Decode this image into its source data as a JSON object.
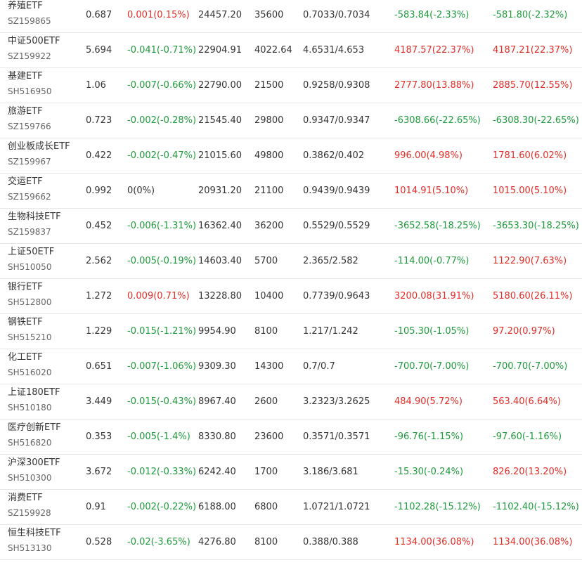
{
  "colors": {
    "up": "#e52d27",
    "down": "#1e9b3c",
    "flat": "#333333",
    "border": "#e8e8e8"
  },
  "rows": [
    {
      "name": "养殖ETF",
      "code": "SZ159865",
      "price": "0.687",
      "change": "0.001(0.15%)",
      "change_dir": "up",
      "amount": "24457.20",
      "shares": "35600",
      "range": "0.7033/0.7034",
      "pl1": "-583.84(-2.33%)",
      "pl1_dir": "down",
      "pl2": "-581.80(-2.32%)",
      "pl2_dir": "down"
    },
    {
      "name": "中证500ETF",
      "code": "SZ159922",
      "price": "5.694",
      "change": "-0.041(-0.71%)",
      "change_dir": "down",
      "amount": "22904.91",
      "shares": "4022.64",
      "range": "4.6531/4.653",
      "pl1": "4187.57(22.37%)",
      "pl1_dir": "up",
      "pl2": "4187.21(22.37%)",
      "pl2_dir": "up"
    },
    {
      "name": "基建ETF",
      "code": "SH516950",
      "price": "1.06",
      "change": "-0.007(-0.66%)",
      "change_dir": "down",
      "amount": "22790.00",
      "shares": "21500",
      "range": "0.9258/0.9308",
      "pl1": "2777.80(13.88%)",
      "pl1_dir": "up",
      "pl2": "2885.70(12.55%)",
      "pl2_dir": "up"
    },
    {
      "name": "旅游ETF",
      "code": "SZ159766",
      "price": "0.723",
      "change": "-0.002(-0.28%)",
      "change_dir": "down",
      "amount": "21545.40",
      "shares": "29800",
      "range": "0.9347/0.9347",
      "pl1": "-6308.66(-22.65%)",
      "pl1_dir": "down",
      "pl2": "-6308.30(-22.65%)",
      "pl2_dir": "down"
    },
    {
      "name": "创业板成长ETF",
      "code": "SZ159967",
      "price": "0.422",
      "change": "-0.002(-0.47%)",
      "change_dir": "down",
      "amount": "21015.60",
      "shares": "49800",
      "range": "0.3862/0.402",
      "pl1": "996.00(4.98%)",
      "pl1_dir": "up",
      "pl2": "1781.60(6.02%)",
      "pl2_dir": "up"
    },
    {
      "name": "交运ETF",
      "code": "SZ159662",
      "price": "0.992",
      "change": "0(0%)",
      "change_dir": "flat",
      "amount": "20931.20",
      "shares": "21100",
      "range": "0.9439/0.9439",
      "pl1": "1014.91(5.10%)",
      "pl1_dir": "up",
      "pl2": "1015.00(5.10%)",
      "pl2_dir": "up"
    },
    {
      "name": "生物科技ETF",
      "code": "SZ159837",
      "price": "0.452",
      "change": "-0.006(-1.31%)",
      "change_dir": "down",
      "amount": "16362.40",
      "shares": "36200",
      "range": "0.5529/0.5529",
      "pl1": "-3652.58(-18.25%)",
      "pl1_dir": "down",
      "pl2": "-3653.30(-18.25%)",
      "pl2_dir": "down"
    },
    {
      "name": "上证50ETF",
      "code": "SH510050",
      "price": "2.562",
      "change": "-0.005(-0.19%)",
      "change_dir": "down",
      "amount": "14603.40",
      "shares": "5700",
      "range": "2.365/2.582",
      "pl1": "-114.00(-0.77%)",
      "pl1_dir": "down",
      "pl2": "1122.90(7.63%)",
      "pl2_dir": "up"
    },
    {
      "name": "银行ETF",
      "code": "SH512800",
      "price": "1.272",
      "change": "0.009(0.71%)",
      "change_dir": "up",
      "amount": "13228.80",
      "shares": "10400",
      "range": "0.7739/0.9643",
      "pl1": "3200.08(31.91%)",
      "pl1_dir": "up",
      "pl2": "5180.60(26.11%)",
      "pl2_dir": "up"
    },
    {
      "name": "钢铁ETF",
      "code": "SH515210",
      "price": "1.229",
      "change": "-0.015(-1.21%)",
      "change_dir": "down",
      "amount": "9954.90",
      "shares": "8100",
      "range": "1.217/1.242",
      "pl1": "-105.30(-1.05%)",
      "pl1_dir": "down",
      "pl2": "97.20(0.97%)",
      "pl2_dir": "up"
    },
    {
      "name": "化工ETF",
      "code": "SH516020",
      "price": "0.651",
      "change": "-0.007(-1.06%)",
      "change_dir": "down",
      "amount": "9309.30",
      "shares": "14300",
      "range": "0.7/0.7",
      "pl1": "-700.70(-7.00%)",
      "pl1_dir": "down",
      "pl2": "-700.70(-7.00%)",
      "pl2_dir": "down"
    },
    {
      "name": "上证180ETF",
      "code": "SH510180",
      "price": "3.449",
      "change": "-0.015(-0.43%)",
      "change_dir": "down",
      "amount": "8967.40",
      "shares": "2600",
      "range": "3.2323/3.2625",
      "pl1": "484.90(5.72%)",
      "pl1_dir": "up",
      "pl2": "563.40(6.64%)",
      "pl2_dir": "up"
    },
    {
      "name": "医疗创新ETF",
      "code": "SH516820",
      "price": "0.353",
      "change": "-0.005(-1.4%)",
      "change_dir": "down",
      "amount": "8330.80",
      "shares": "23600",
      "range": "0.3571/0.3571",
      "pl1": "-96.76(-1.15%)",
      "pl1_dir": "down",
      "pl2": "-97.60(-1.16%)",
      "pl2_dir": "down"
    },
    {
      "name": "沪深300ETF",
      "code": "SH510300",
      "price": "3.672",
      "change": "-0.012(-0.33%)",
      "change_dir": "down",
      "amount": "6242.40",
      "shares": "1700",
      "range": "3.186/3.681",
      "pl1": "-15.30(-0.24%)",
      "pl1_dir": "down",
      "pl2": "826.20(13.20%)",
      "pl2_dir": "up"
    },
    {
      "name": "消费ETF",
      "code": "SZ159928",
      "price": "0.91",
      "change": "-0.002(-0.22%)",
      "change_dir": "down",
      "amount": "6188.00",
      "shares": "6800",
      "range": "1.0721/1.0721",
      "pl1": "-1102.28(-15.12%)",
      "pl1_dir": "down",
      "pl2": "-1102.40(-15.12%)",
      "pl2_dir": "down"
    },
    {
      "name": "恒生科技ETF",
      "code": "SH513130",
      "price": "0.528",
      "change": "-0.02(-3.65%)",
      "change_dir": "down",
      "amount": "4276.80",
      "shares": "8100",
      "range": "0.388/0.388",
      "pl1": "1134.00(36.08%)",
      "pl1_dir": "up",
      "pl2": "1134.00(36.08%)",
      "pl2_dir": "up"
    }
  ]
}
